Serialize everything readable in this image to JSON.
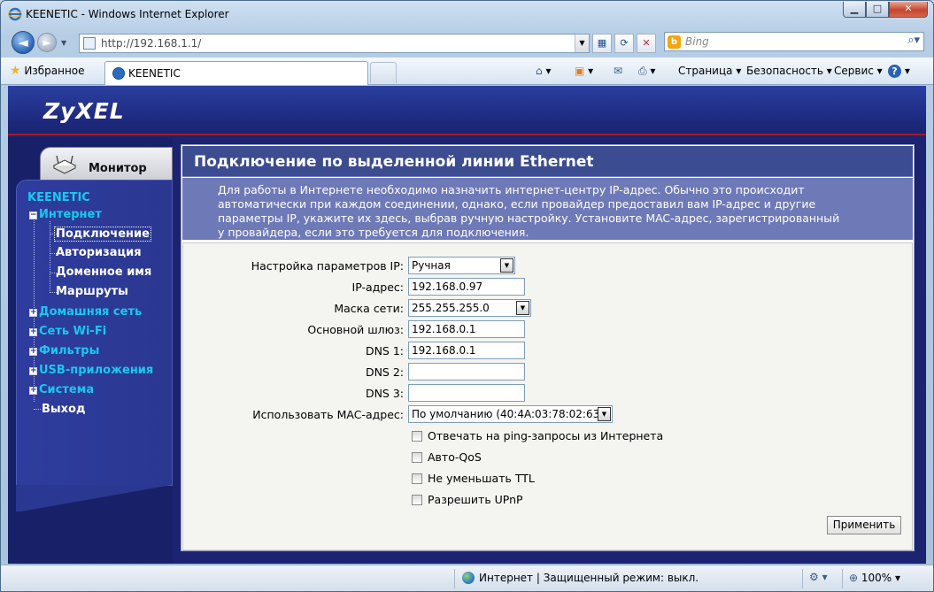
{
  "window": {
    "title": "KEENETIC - Windows Internet Explorer",
    "btn_min": "▁",
    "btn_max": "□",
    "btn_close": "✕"
  },
  "navbar": {
    "back_glyph": "◄",
    "forward_glyph": "►",
    "address": "http://192.168.1.1/",
    "search_placeholder": "Bing",
    "search_logo": "b",
    "icons": [
      "page-icon",
      "compatibility-icon",
      "refresh-icon",
      "stop-icon",
      "search-go-icon"
    ]
  },
  "favbar": {
    "favorites_label": "Избранное",
    "tab_label": "KEENETIC",
    "page_menu": "Страница",
    "safety_menu": "Безопасность",
    "tools_menu": "Сервис",
    "help_glyph": "?"
  },
  "router": {
    "logo": "ZyXEL",
    "monitor_tab": "Монитор",
    "menu": {
      "root": "KEENETIC",
      "internet": "Интернет",
      "connection": "Подключение",
      "authorization": "Авторизация",
      "domain_name": "Доменное имя",
      "routes": "Маршруты",
      "home_network": "Домашняя сеть",
      "wifi": "Сеть Wi-Fi",
      "filters": "Фильтры",
      "usb_apps": "USB-приложения",
      "system": "Система",
      "exit": "Выход"
    },
    "page": {
      "heading": "Подключение по выделенной линии Ethernet",
      "description_lines": [
        "Для работы в Интернете необходимо назначить интернет-центру IP-адрес. Обычно это происходит",
        "автоматически при каждом соединении, однако, если провайдер предоставил вам IP-адрес и другие",
        "параметры IP, укажите их здесь, выбрав ручную настройку. Установите MAC-адрес, зарегистрированный",
        "у провайдера, если это требуется для подключения."
      ],
      "form": {
        "ip_mode_label": "Настройка параметров IP:",
        "ip_mode_value": "Ручная",
        "ip_label": "IP-адрес:",
        "ip_value": "192.168.0.97",
        "mask_label": "Маска сети:",
        "mask_value": "255.255.255.0",
        "gateway_label": "Основной шлюз:",
        "gateway_value": "192.168.0.1",
        "dns1_label": "DNS 1:",
        "dns1_value": "192.168.0.1",
        "dns2_label": "DNS 2:",
        "dns2_value": "",
        "dns3_label": "DNS 3:",
        "dns3_value": "",
        "mac_label": "Использовать MAC-адрес:",
        "mac_value": "По умолчанию (40:4A:03:78:02:63)",
        "cb_ping": "Отвечать на ping-запросы из Интернета",
        "cb_qos": "Авто-QoS",
        "cb_ttl": "Не уменьшать TTL",
        "cb_upnp": "Разрешить UPnP",
        "apply": "Применить"
      }
    }
  },
  "statusbar": {
    "zone": "Интернет | Защищенный режим: выкл.",
    "zoom": "100%"
  }
}
